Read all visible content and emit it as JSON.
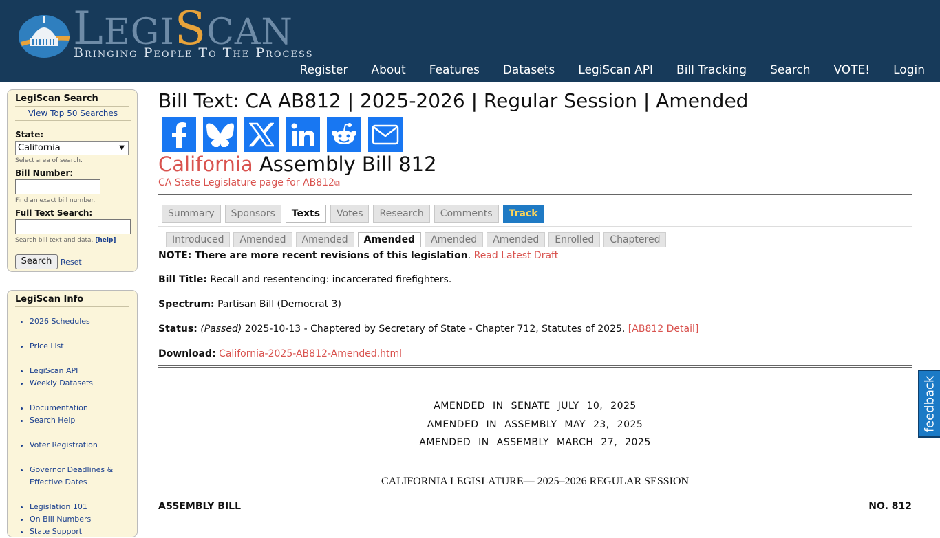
{
  "header": {
    "logo_first": "L",
    "logo_mid": "EGI",
    "logo_s": "S",
    "logo_end": "CAN",
    "tagline": "Bringing People To The Process",
    "nav": [
      "Register",
      "About",
      "Features",
      "Datasets",
      "LegiScan API",
      "Bill Tracking",
      "Search",
      "VOTE!",
      "Login"
    ]
  },
  "search_box": {
    "title": "LegiScan Search",
    "top_searches": "View Top 50 Searches",
    "state_label": "State:",
    "state_value": "California",
    "state_hint": "Select area of search.",
    "bill_label": "Bill Number:",
    "bill_value": "",
    "bill_hint": "Find an exact bill number.",
    "fulltext_label": "Full Text Search:",
    "fulltext_value": "",
    "fulltext_hint": "Search bill text and data.",
    "help": "[help]",
    "search_button": "Search",
    "reset": "Reset"
  },
  "info_box": {
    "title": "LegiScan Info",
    "items": [
      "2026 Schedules",
      "Price List",
      "LegiScan API",
      "Weekly Datasets",
      "Documentation",
      "Search Help",
      "Voter Registration",
      "Governor Deadlines & Effective Dates",
      "Legislation 101",
      "On Bill Numbers",
      "State Support"
    ]
  },
  "main": {
    "title": "Bill Text: CA AB812 | 2025-2026 | Regular Session | Amended",
    "share_icons": [
      "facebook-icon",
      "bluesky-icon",
      "x-icon",
      "linkedin-icon",
      "reddit-icon",
      "email-icon"
    ],
    "bill_state": "California",
    "bill_name": "Assembly Bill 812",
    "leg_link": "CA State Legislature page for AB812",
    "tabs": [
      "Summary",
      "Sponsors",
      "Texts",
      "Votes",
      "Research",
      "Comments",
      "Track"
    ],
    "subtabs": [
      "Introduced",
      "Amended",
      "Amended",
      "Amended",
      "Amended",
      "Amended",
      "Enrolled",
      "Chaptered"
    ],
    "note_bold": "NOTE: There are more recent revisions of this legislation",
    "note_link": "Read Latest Draft",
    "bill_title_label": "Bill Title:",
    "bill_title": "Recall and resentencing: incarcerated firefighters.",
    "spectrum_label": "Spectrum:",
    "spectrum": "Partisan Bill (Democrat 3)",
    "status_label": "Status:",
    "status_passed": "(Passed)",
    "status_text": "2025-10-13 - Chaptered by Secretary of State - Chapter 712, Statutes of 2025.",
    "status_link": "[AB812 Detail]",
    "download_label": "Download:",
    "download_link": "California-2025-AB812-Amended.html",
    "amend_lines": [
      "AMENDED IN SENATE JULY 10, 2025",
      "AMENDED IN ASSEMBLY MAY 23, 2025",
      "AMENDED IN ASSEMBLY MARCH 27, 2025"
    ],
    "legislature": "CALIFORNIA LEGISLATURE— 2025–2026 REGULAR SESSION",
    "ab_left": "ASSEMBLY BILL",
    "ab_right": "NO. 812"
  },
  "feedback": "feedback",
  "colors": {
    "header_bg": "#173a5a",
    "link_red": "#d9534f",
    "sidebar_bg": "#fbf5da",
    "share_blue": "#1877f2",
    "track_blue": "#1f7ac4"
  }
}
